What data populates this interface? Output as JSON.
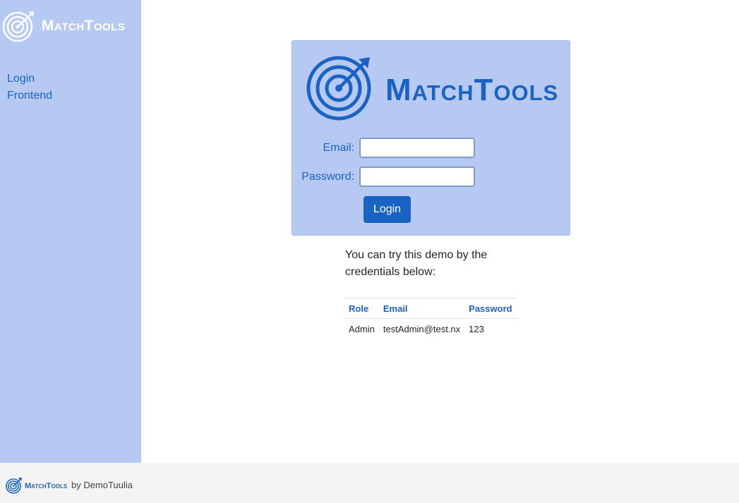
{
  "brand": {
    "name_first_cap": "M",
    "name_first_rest": "ATCH",
    "name_second_cap": "T",
    "name_second_rest": "OOLS"
  },
  "sidebar": {
    "nav": [
      {
        "label": "Login"
      },
      {
        "label": "Frontend"
      }
    ]
  },
  "login": {
    "email_label": "Email:",
    "email_value": "",
    "password_label": "Password:",
    "password_value": "",
    "submit_label": "Login"
  },
  "demo": {
    "text": "You can try this demo by the credentials below:",
    "columns": [
      "Role",
      "Email",
      "Password"
    ],
    "rows": [
      [
        "Admin",
        "testAdmin@test.nx",
        "123"
      ]
    ]
  },
  "footer": {
    "by_text": "by DemoTuulia"
  },
  "colors": {
    "sidebar_bg": "#b6c9f2",
    "accent": "#1a63c2",
    "footer_bg": "#f4f4f4"
  },
  "icons": {
    "logo": "target-arrow-icon"
  }
}
